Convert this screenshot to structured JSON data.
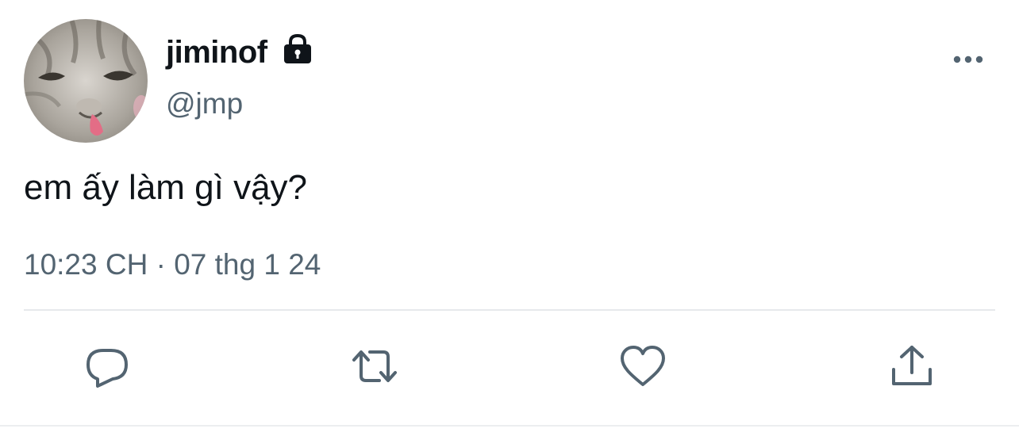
{
  "user": {
    "display_name": "jiminof",
    "handle": "@jmp",
    "protected_icon": "lock-icon",
    "avatar": "cat-photo"
  },
  "tweet": {
    "text": "em ấy làm gì vậy?",
    "time": "10:23 CH",
    "separator": "·",
    "date": "07 thg 1 24"
  },
  "actions": [
    {
      "icon": "reply-icon"
    },
    {
      "icon": "retweet-icon"
    },
    {
      "icon": "like-icon"
    },
    {
      "icon": "share-icon"
    }
  ],
  "colors": {
    "text": "#0f1419",
    "secondary": "#536471",
    "icon": "#536471",
    "divider": "#e6e9ec"
  }
}
